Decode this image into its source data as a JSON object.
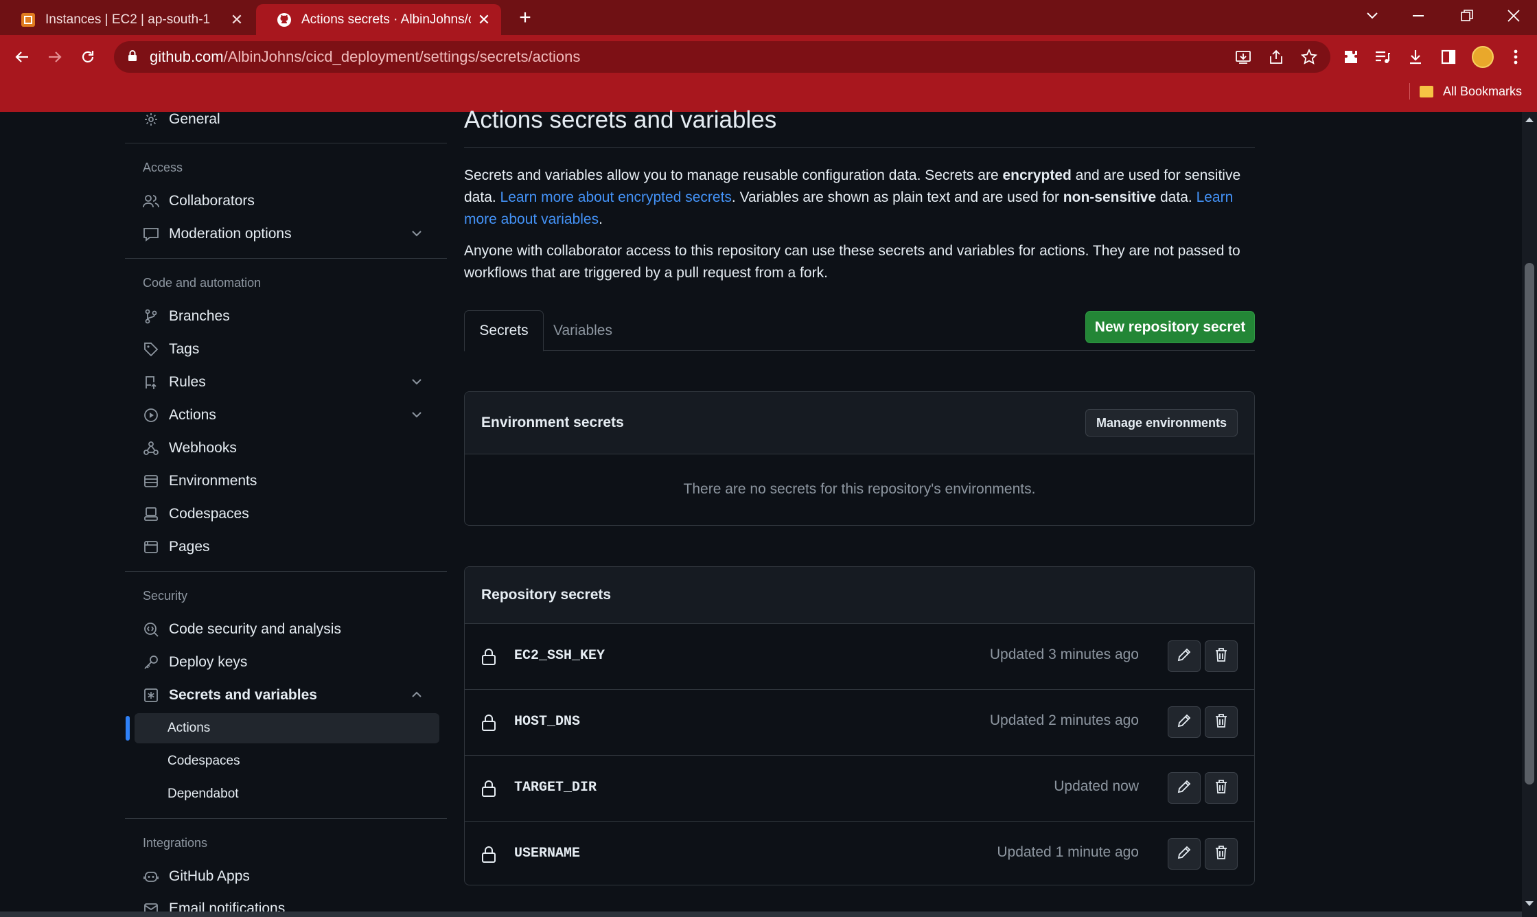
{
  "browser": {
    "tabs": [
      {
        "title": "Instances | EC2 | ap-south-1",
        "active": false
      },
      {
        "title": "Actions secrets · AlbinJohns/cicd_deployment",
        "active": true
      }
    ],
    "url_host": "github.com",
    "url_path": "/AlbinJohns/cicd_deployment/settings/secrets/actions",
    "bookmarks_label": "All Bookmarks",
    "accent_color": "#a8171e"
  },
  "sidebar": {
    "general": "General",
    "access": {
      "heading": "Access",
      "collaborators": "Collaborators",
      "moderation": "Moderation options"
    },
    "code": {
      "heading": "Code and automation",
      "branches": "Branches",
      "tags": "Tags",
      "rules": "Rules",
      "actions": "Actions",
      "webhooks": "Webhooks",
      "environments": "Environments",
      "codespaces": "Codespaces",
      "pages": "Pages"
    },
    "security": {
      "heading": "Security",
      "code_security": "Code security and analysis",
      "deploy_keys": "Deploy keys",
      "secrets_vars": "Secrets and variables",
      "sub_actions": "Actions",
      "sub_codespaces": "Codespaces",
      "sub_dependabot": "Dependabot"
    },
    "integrations": {
      "heading": "Integrations",
      "github_apps": "GitHub Apps",
      "email_notifications": "Email notifications"
    }
  },
  "main": {
    "title": "Actions secrets and variables",
    "intro": {
      "p1_a": "Secrets and variables allow you to manage reusable configuration data. Secrets are ",
      "p1_b": "encrypted",
      "p1_c": " and are used for sensitive data. ",
      "p1_link1": "Learn more about encrypted secrets",
      "p1_d": ". Variables are shown as plain text and are used for ",
      "p1_e": "non-sensitive",
      "p1_f": " data. ",
      "p1_link2": "Learn more about variables",
      "p1_g": ".",
      "p2": "Anyone with collaborator access to this repository can use these secrets and variables for actions. They are not passed to workflows that are triggered by a pull request from a fork."
    },
    "tabs": {
      "secrets": "Secrets",
      "variables": "Variables"
    },
    "new_secret_button": "New repository secret",
    "environment_secrets": {
      "title": "Environment secrets",
      "manage_button": "Manage environments",
      "empty": "There are no secrets for this repository's environments."
    },
    "repository_secrets": {
      "title": "Repository secrets",
      "items": [
        {
          "name": "EC2_SSH_KEY",
          "updated": "Updated 3 minutes ago"
        },
        {
          "name": "HOST_DNS",
          "updated": "Updated 2 minutes ago"
        },
        {
          "name": "TARGET_DIR",
          "updated": "Updated now"
        },
        {
          "name": "USERNAME",
          "updated": "Updated 1 minute ago"
        }
      ]
    }
  }
}
